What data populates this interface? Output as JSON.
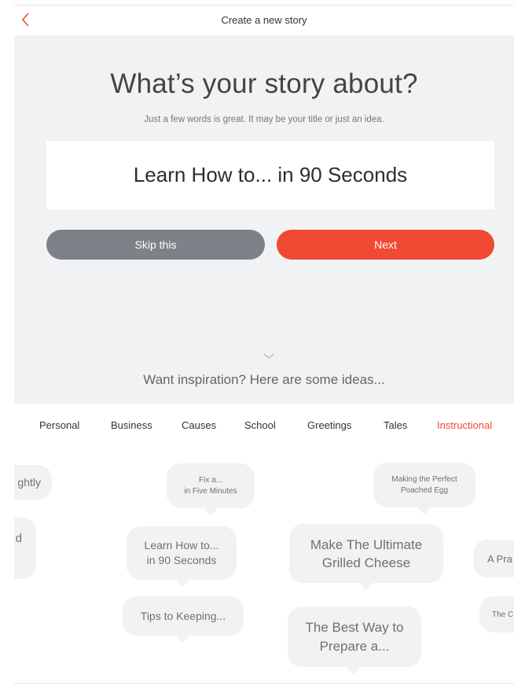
{
  "header": {
    "title": "Create a new story",
    "back_icon": "chevron-left-icon",
    "accent_color": "#f04a34"
  },
  "prompt": {
    "heading": "What’s your story about?",
    "subheading": "Just a few words is great. It may be your title or just an idea.",
    "input_value": "Learn How to... in 90 Seconds"
  },
  "buttons": {
    "skip_label": "Skip this",
    "next_label": "Next"
  },
  "inspiration": {
    "expand_icon": "chevron-down-icon",
    "text": "Want inspiration? Here are some ideas..."
  },
  "tabs": [
    {
      "label": "Personal"
    },
    {
      "label": "Business"
    },
    {
      "label": "Causes"
    },
    {
      "label": "School"
    },
    {
      "label": "Greetings"
    },
    {
      "label": "Tales"
    },
    {
      "label": "Instructional",
      "active": true
    }
  ],
  "ideas": [
    {
      "text": "ghtly"
    },
    {
      "text": "Fix a...\nin Five Minutes"
    },
    {
      "text": "Making the Perfect\nPoached Egg"
    },
    {
      "text": "d"
    },
    {
      "text": "Learn How to...\nin 90 Seconds"
    },
    {
      "text": "Make The Ultimate\nGrilled Cheese"
    },
    {
      "text": "A Pra"
    },
    {
      "text": "Tips to Keeping..."
    },
    {
      "text": "The Best Way to\nPrepare a..."
    },
    {
      "text": "The C"
    }
  ]
}
